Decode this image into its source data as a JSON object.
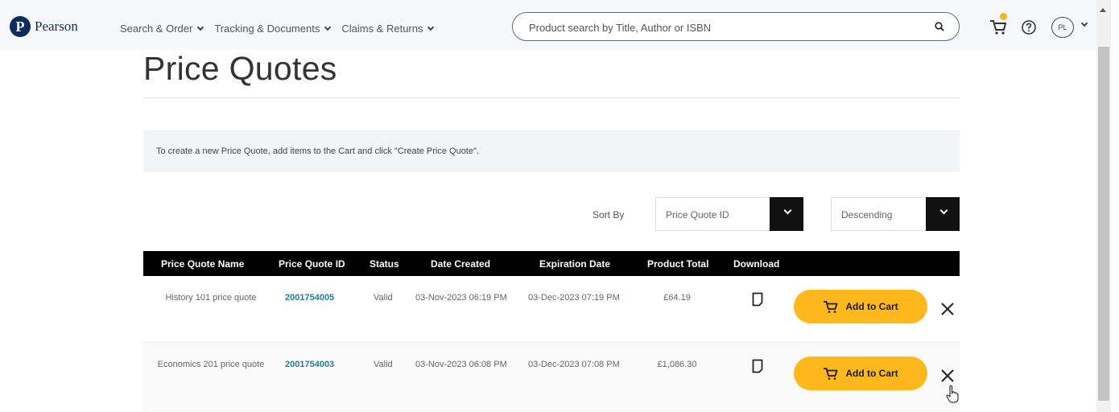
{
  "header": {
    "logo_text": "Pearson",
    "logo_mark": "P",
    "nav": [
      {
        "label": "Search & Order"
      },
      {
        "label": "Tracking & Documents"
      },
      {
        "label": "Claims & Returns"
      }
    ],
    "search_placeholder": "Product search by Title, Author or ISBN",
    "avatar_initials": "PL",
    "icons": [
      "search-icon",
      "cart-icon",
      "help-icon",
      "chevron-down-icon"
    ],
    "cart_badge_color": "#f5b324"
  },
  "page": {
    "title": "Price Quotes",
    "info": "To create a new Price Quote, add items to the Cart and click \"Create Price Quote\"."
  },
  "sort": {
    "label": "Sort By",
    "field_value": "Price Quote ID",
    "order_value": "Descending"
  },
  "table": {
    "headers": [
      "Price Quote Name",
      "Price Quote ID",
      "Status",
      "Date Created",
      "Expiration Date",
      "Product Total",
      "Download"
    ],
    "rows": [
      {
        "name": "History 101 price quote",
        "id": "2001754005",
        "status": "Valid",
        "created": "03-Nov-2023 06:19 PM",
        "expires": "03-Dec-2023 07:19 PM",
        "total": "£64.19",
        "add_label": "Add to Cart"
      },
      {
        "name": "Economics 201 price quote",
        "id": "2001754003",
        "status": "Valid",
        "created": "03-Nov-2023 06:08 PM",
        "expires": "03-Dec-2023 07:08 PM",
        "total": "£1,086.30",
        "add_label": "Add to Cart"
      }
    ]
  },
  "colors": {
    "accent": "#ffb81c",
    "link": "#1e7fa0",
    "header_bg": "#000000",
    "brand": "#0c2c5c"
  }
}
